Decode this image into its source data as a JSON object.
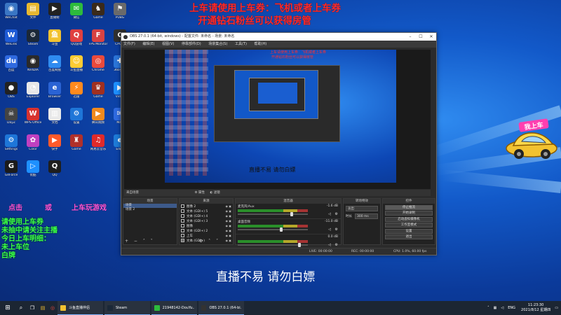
{
  "overlay": {
    "line1": "上车请使用上车券：飞机或者上车券",
    "line2": "开通钻石粉丝可以获得房管",
    "promo_red": "点击",
    "promo_red2": "或",
    "promo_right": "上车玩游戏",
    "promo_lines": [
      "请使用上车券",
      "未抽中请关注主播",
      "今日上车明细：",
      "未上车位",
      "白牌"
    ],
    "watermark": "直播不易 请勿白嫖",
    "car_sign": "我上车"
  },
  "desktop_icons": [
    {
      "label": "WeChat",
      "icon": "user-icon",
      "color": "#3a76c4",
      "glyph": "◉"
    },
    {
      "label": "文件",
      "icon": "folder-icon",
      "color": "#e8b830",
      "glyph": "▤"
    },
    {
      "label": "直播姬",
      "icon": "game-icon",
      "color": "#222",
      "glyph": "▶"
    },
    {
      "label": "微信",
      "icon": "wechat-icon",
      "color": "#2dbb3c",
      "glyph": "✉"
    },
    {
      "label": "Game",
      "icon": "game-icon",
      "color": "#3a2a1a",
      "glyph": "♞"
    },
    {
      "label": "PUBG",
      "icon": "game-icon",
      "color": "#6a6a6a",
      "glyph": "⚑"
    },
    {
      "label": "WeLink",
      "icon": "app-icon",
      "color": "#1e5bd6",
      "glyph": "W"
    },
    {
      "label": "Steam",
      "icon": "steam-icon",
      "color": "#1b2838",
      "glyph": "⚙"
    },
    {
      "label": "斗鱼",
      "icon": "app-icon",
      "color": "#f2c230",
      "glyph": "鱼"
    },
    {
      "label": "QQ游戏",
      "icon": "app-icon",
      "color": "#e04040",
      "glyph": "Q"
    },
    {
      "label": "FPS Monitor",
      "icon": "app-icon",
      "color": "#d84242",
      "glyph": "F"
    },
    {
      "label": "CPU-Z",
      "icon": "chip-icon",
      "color": "#303030",
      "glyph": "C"
    },
    {
      "label": "百度",
      "icon": "app-icon",
      "color": "#2f6ae0",
      "glyph": "du"
    },
    {
      "label": "NVIDIA",
      "icon": "nvidia-icon",
      "color": "#2a2a2a",
      "glyph": "◉"
    },
    {
      "label": "百度网盘",
      "icon": "cloud-icon",
      "color": "#2f8bf0",
      "glyph": "☁"
    },
    {
      "label": "斗鱼直播",
      "icon": "app-icon",
      "color": "#ffcc33",
      "glyph": "☺"
    },
    {
      "label": "Chrome",
      "icon": "chrome-icon",
      "color": "#e84a3c",
      "glyph": "◎"
    },
    {
      "label": "360安全",
      "icon": "shield-icon",
      "color": "#2b75d9",
      "glyph": "✚"
    },
    {
      "label": "OBS",
      "icon": "obs-icon",
      "color": "#222",
      "glyph": "●"
    },
    {
      "label": "Explorer",
      "icon": "app-icon",
      "color": "#e8e8e8",
      "glyph": "◔"
    },
    {
      "label": "Browser",
      "icon": "app-icon",
      "color": "#2a63d4",
      "glyph": "e"
    },
    {
      "label": "迅雷",
      "icon": "thunder-icon",
      "color": "#ff8a1e",
      "glyph": "⚡"
    },
    {
      "label": "Game",
      "icon": "game-icon",
      "color": "#a03020",
      "glyph": "♛"
    },
    {
      "label": "Video",
      "icon": "video-icon",
      "color": "#1e90ff",
      "glyph": "▶"
    },
    {
      "label": "DayZ",
      "icon": "game-icon",
      "color": "#444",
      "glyph": "☠"
    },
    {
      "label": "WPS Office",
      "icon": "wps-icon",
      "color": "#d8322f",
      "glyph": "W"
    },
    {
      "label": "文档",
      "icon": "document-icon",
      "color": "#eaeaea",
      "glyph": "▥"
    },
    {
      "label": "设置",
      "icon": "gear-icon",
      "color": "#1e76d8",
      "glyph": "⚙"
    },
    {
      "label": "腾讯视频",
      "icon": "video-icon",
      "color": "#f08a1e",
      "glyph": "▶"
    },
    {
      "label": "Mail",
      "icon": "mail-icon",
      "color": "#2f6ae0",
      "glyph": "✉"
    },
    {
      "label": "Settings",
      "icon": "settings-icon",
      "color": "#1e76d8",
      "glyph": "⚙"
    },
    {
      "label": "Color",
      "icon": "app-icon",
      "color": "#c040c0",
      "glyph": "✿"
    },
    {
      "label": "快手",
      "icon": "app-icon",
      "color": "#ff5a2a",
      "glyph": "▶"
    },
    {
      "label": "Game",
      "icon": "game-icon",
      "color": "#b0302a",
      "glyph": "♜"
    },
    {
      "label": "网易云音乐",
      "icon": "music-icon",
      "color": "#e02a2a",
      "glyph": "♫"
    },
    {
      "label": "Edge",
      "icon": "edge-icon",
      "color": "#1e7bd8",
      "glyph": "e"
    },
    {
      "label": "GeForce",
      "icon": "app-icon",
      "color": "#1b1b1b",
      "glyph": "G"
    },
    {
      "label": "优酷",
      "icon": "app-icon",
      "color": "#1e90ff",
      "glyph": "▷"
    },
    {
      "label": "QQ",
      "icon": "qq-icon",
      "color": "#1e1e1e",
      "glyph": "Q"
    }
  ],
  "obs": {
    "title": "OBS 27.0.1 (64-bit, windows) - 配置文件: 未命名 - 场景: 未命名",
    "menu": [
      "文件(F)",
      "编辑(E)",
      "视图(V)",
      "停靠部件(D)",
      "场景集合(S)",
      "工具(T)",
      "帮助(H)"
    ],
    "preview_text": "直播不易 请勿白嫖",
    "scene_bar": "来自场景",
    "scene_bar_props": "属性",
    "scene_bar_filters": "滤镜",
    "scenes": {
      "title": "场景",
      "items": [
        "场景",
        "场景 2"
      ]
    },
    "sources": {
      "title": "来源",
      "items": [
        "图像 2",
        "文本 (GDI+) 5",
        "文本 (GDI+) 4",
        "文本 (GDI+) 3",
        "图像",
        "文本 (GDI+) 2",
        "上车",
        "文本 (GDI+)"
      ]
    },
    "mixer": {
      "title": "混音器",
      "channels": [
        {
          "name": "麦克风/Aux",
          "db": "-1.6 dB",
          "level": 0.78
        },
        {
          "name": "桌面音频",
          "db": "-11.0 dB",
          "level": 0.62
        },
        {
          "name": "",
          "db": "0.0 dB",
          "level": 0.9
        }
      ]
    },
    "transitions": {
      "title": "转场特效",
      "type": "淡出",
      "duration_label": "时长",
      "duration": "300 ms"
    },
    "controls": {
      "title": "控件",
      "buttons": [
        "停止推流",
        "开始录制",
        "启动虚拟摄像机",
        "工作室模式",
        "设置",
        "退出"
      ]
    },
    "status": {
      "live": "LIVE: 00:00:00",
      "rec": "REC: 00:00:00",
      "cpu": "CPU: 1.0%, 60.00 fps",
      "dropped": "00:00:00"
    }
  },
  "taskbar": {
    "start_icon": "windows-icon",
    "search_icon": "search-icon",
    "apps": [
      {
        "label": "斗鱼直播伴侣",
        "color": "#f2c230"
      },
      {
        "label": "Steam",
        "color": "#1b2838"
      },
      {
        "label": "21948142-DouYu...",
        "color": "#2dbb3c"
      },
      {
        "label": "OBS 27.0.1 (64-bi...",
        "color": "#333"
      }
    ],
    "tray_lang": "ENG",
    "time": "11:23:30",
    "date": "2021/8/12 星期四"
  }
}
